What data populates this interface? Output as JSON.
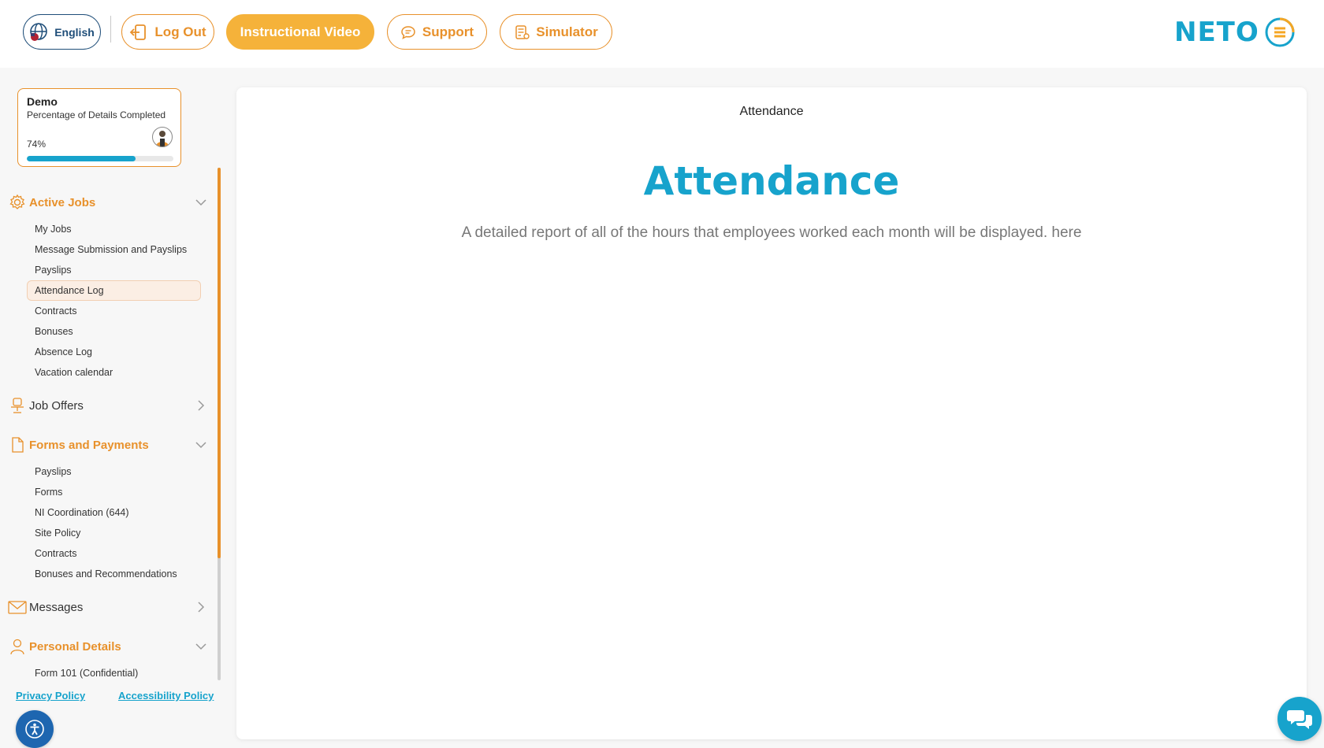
{
  "header": {
    "language_label": "English",
    "logout_label": "Log Out",
    "video_label": "Instructional Video",
    "support_label": "Support",
    "simulator_label": "Simulator",
    "logo_text": "NETO"
  },
  "profile_card": {
    "name": "Demo",
    "subtitle": "Percentage of Details Completed",
    "percent_label": "74%",
    "progress": 0.74
  },
  "sidebar": {
    "active_jobs": {
      "label": "Active Jobs",
      "items": [
        "My Jobs",
        "Message Submission and Payslips",
        "Payslips",
        "Attendance Log",
        "Contracts",
        "Bonuses",
        "Absence Log",
        "Vacation calendar"
      ]
    },
    "job_offers": {
      "label": "Job Offers"
    },
    "forms_payments": {
      "label": "Forms and Payments",
      "items": [
        "Payslips",
        "Forms",
        "NI Coordination (644)",
        "Site Policy",
        "Contracts",
        "Bonuses and Recommendations"
      ]
    },
    "messages": {
      "label": "Messages"
    },
    "personal_details": {
      "label": "Personal Details",
      "items": [
        "Form 101 (Confidential)"
      ]
    },
    "selected_item": "Attendance Log"
  },
  "footer": {
    "privacy_label": "Privacy Policy",
    "accessibility_label": "Accessibility Policy"
  },
  "main": {
    "breadcrumb_title": "Attendance",
    "heading": "Attendance",
    "description": "A detailed report of all of the hours that employees worked each month will be displayed. here"
  },
  "colors": {
    "accent_orange": "#e8912b",
    "brand_blue": "#17a3cc",
    "video_button": "#f5b23a"
  }
}
